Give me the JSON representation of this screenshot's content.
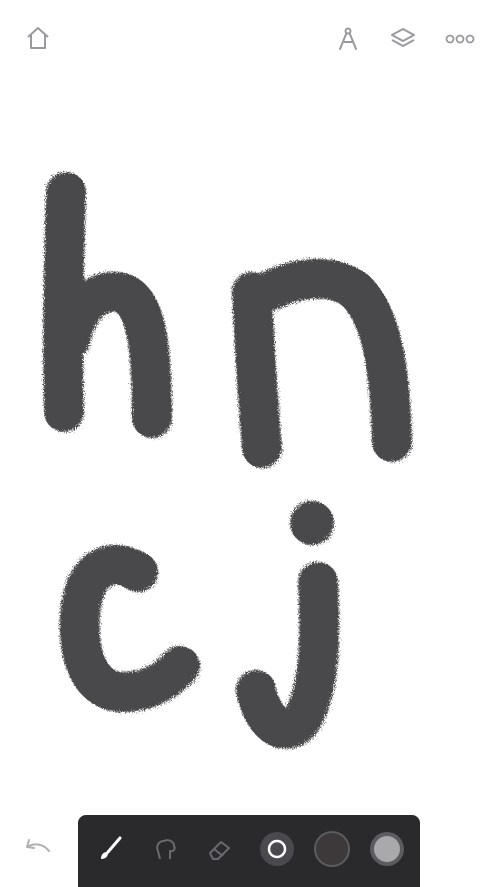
{
  "app": {
    "title": "",
    "accent_color": "#3a3a3c"
  },
  "top_bar": {
    "left": [
      {
        "icon": "home-icon"
      }
    ],
    "right": [
      {
        "icon": "ruler-compass-icon"
      },
      {
        "icon": "layers-icon"
      },
      {
        "icon": "more-icon"
      }
    ]
  },
  "canvas": {
    "stroke_color": "#4a4a4c",
    "drawn_letters": [
      "h",
      "n",
      "c",
      "j"
    ]
  },
  "bottom_toolbar": {
    "tools": [
      {
        "icon": "brush-icon",
        "active": true
      },
      {
        "icon": "smudge-icon",
        "active": false
      },
      {
        "icon": "eraser-icon",
        "active": false
      },
      {
        "icon": "brush-size-icon",
        "active": false
      },
      {
        "icon": "color-swatch-icon",
        "color": "#3d393b"
      },
      {
        "icon": "opacity-icon",
        "color": "#a9a9ab"
      }
    ],
    "undo_icon": "undo-icon"
  }
}
